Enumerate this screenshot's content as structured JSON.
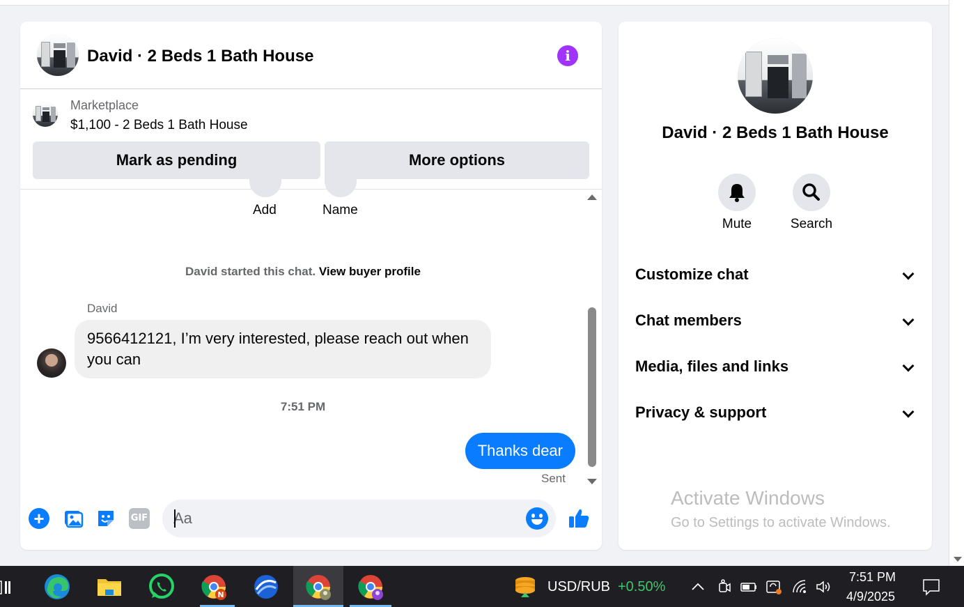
{
  "conversation": {
    "title": "David · 2 Beds 1 Bath House",
    "info_icon": "info-icon"
  },
  "marketplace": {
    "label": "Marketplace",
    "listing": "$1,100 - 2 Beds 1 Bath House",
    "pending_button": "Mark as pending",
    "more_button": "More options"
  },
  "thread": {
    "actions": {
      "add": "Add",
      "name": "Name"
    },
    "started_text": "David started this chat.",
    "buyer_profile_link": "View buyer profile",
    "sender": "David",
    "incoming_message": "9566412121, I’m very interested, please reach out when you can",
    "timestamp": "7:51 PM",
    "outgoing_message": "Thanks dear",
    "status": "Sent"
  },
  "composer": {
    "placeholder": "Aa",
    "gif_label": "GIF",
    "plus_icon": "+"
  },
  "info_panel": {
    "title": "David · 2 Beds 1 Bath House",
    "mute_label": "Mute",
    "search_label": "Search",
    "sections": [
      "Customize chat",
      "Chat members",
      "Media, files and links",
      "Privacy & support"
    ]
  },
  "watermark": {
    "line1": "Activate Windows",
    "line2": "Go to Settings to activate Windows."
  },
  "taskbar": {
    "ticker_symbol": "USD/RUB",
    "ticker_change": "+0.50%",
    "time": "7:51 PM",
    "date": "4/9/2025"
  },
  "colors": {
    "accent": "#0a7cff",
    "info": "#a033ff",
    "positive": "#3fc66a"
  }
}
